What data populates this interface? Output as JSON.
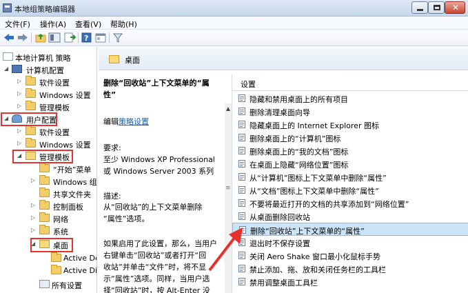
{
  "window": {
    "title": "本地组策略编辑器"
  },
  "menu": [
    "文件(F)",
    "操作(A)",
    "查看(V)",
    "帮助(H)"
  ],
  "toolbar": {
    "icons": [
      "back-arrow-icon",
      "forward-arrow-icon",
      "up-folder-icon",
      "show-hide-tree-icon",
      "export-list-icon",
      "help-icon",
      "properties-icon",
      "filter-icon"
    ]
  },
  "colors": {
    "highlight_red": "#e8312c",
    "selected_row": "#cce4f7"
  },
  "tree": [
    {
      "label": "本地计算机 策略",
      "icon": "policy-icon"
    },
    {
      "label": "计算机配置",
      "icon": "computer-icon",
      "expanded": true
    },
    {
      "label": "软件设置",
      "icon": "folder-icon"
    },
    {
      "label": "Windows 设置",
      "icon": "folder-icon"
    },
    {
      "label": "管理模板",
      "icon": "folder-icon"
    },
    {
      "label": "用户配置",
      "icon": "user-icon",
      "expanded": true,
      "highlighted": true
    },
    {
      "label": "软件设置",
      "icon": "folder-icon"
    },
    {
      "label": "Windows 设置",
      "icon": "folder-icon"
    },
    {
      "label": "管理模板",
      "icon": "folder-icon",
      "expanded": true,
      "highlighted": true
    },
    {
      "label": "“开始”菜单",
      "icon": "folder-icon"
    },
    {
      "label": "Windows 组件",
      "icon": "folder-icon"
    },
    {
      "label": "共享文件夹",
      "icon": "folder-icon"
    },
    {
      "label": "控制面板",
      "icon": "folder-icon"
    },
    {
      "label": "网络",
      "icon": "folder-icon"
    },
    {
      "label": "系统",
      "icon": "folder-icon"
    },
    {
      "label": "桌面",
      "icon": "folder-icon",
      "expanded": true,
      "highlighted": true
    },
    {
      "label": "Active Desktop",
      "icon": "folder-icon"
    },
    {
      "label": "Active Directory",
      "icon": "folder-icon"
    },
    {
      "label": "所有设置",
      "icon": "folder-icon"
    }
  ],
  "details": {
    "header": "桌面",
    "policy_title": [
      "删除“回收站”上下文菜单的“属",
      "性”"
    ],
    "edit_prefix": "编辑",
    "edit_link": "策略设置",
    "req_label": "要求:",
    "req_text": [
      "至少 Windows XP Professional",
      "或 Windows Server 2003 系列"
    ],
    "desc_label": "描述:",
    "desc_text": [
      "从“回收站”的上下文菜单删除",
      "“属性”选项。"
    ],
    "desc_more": [
      "如果启用了此设置，那么，当用户",
      "右键单击“回收站”或者打开“回",
      "收站”并单击“文件”时，将不显",
      "示“属性”选项。同样，当用户选",
      "择“回收站”时，按 Alt-Enter 没"
    ]
  },
  "list": {
    "column": "设置",
    "items": [
      "隐藏和禁用桌面上的所有项目",
      "删除清理桌面向导",
      "隐藏桌面上的 Internet Explorer 图标",
      "删除桌面上的“计算机”图标",
      "删除桌面上的“我的文档”图标",
      "在桌面上隐藏“网络位置”图标",
      "从“计算机”图标上下文菜单中删除“属性”",
      "从“文档”图标上下文菜单中删除“属性”",
      "不要将最近打开的文档的共享添加到“网络位置”",
      "从桌面删除回收站",
      "删除“回收站”上下文菜单的“属性”",
      "退出时不保存设置",
      "关闭 Aero Shake 窗口最小化鼠标手势",
      "禁止添加、拖、放和关闭任务栏的工具栏",
      "禁用调整桌面工具栏"
    ],
    "selected_index": 10
  }
}
